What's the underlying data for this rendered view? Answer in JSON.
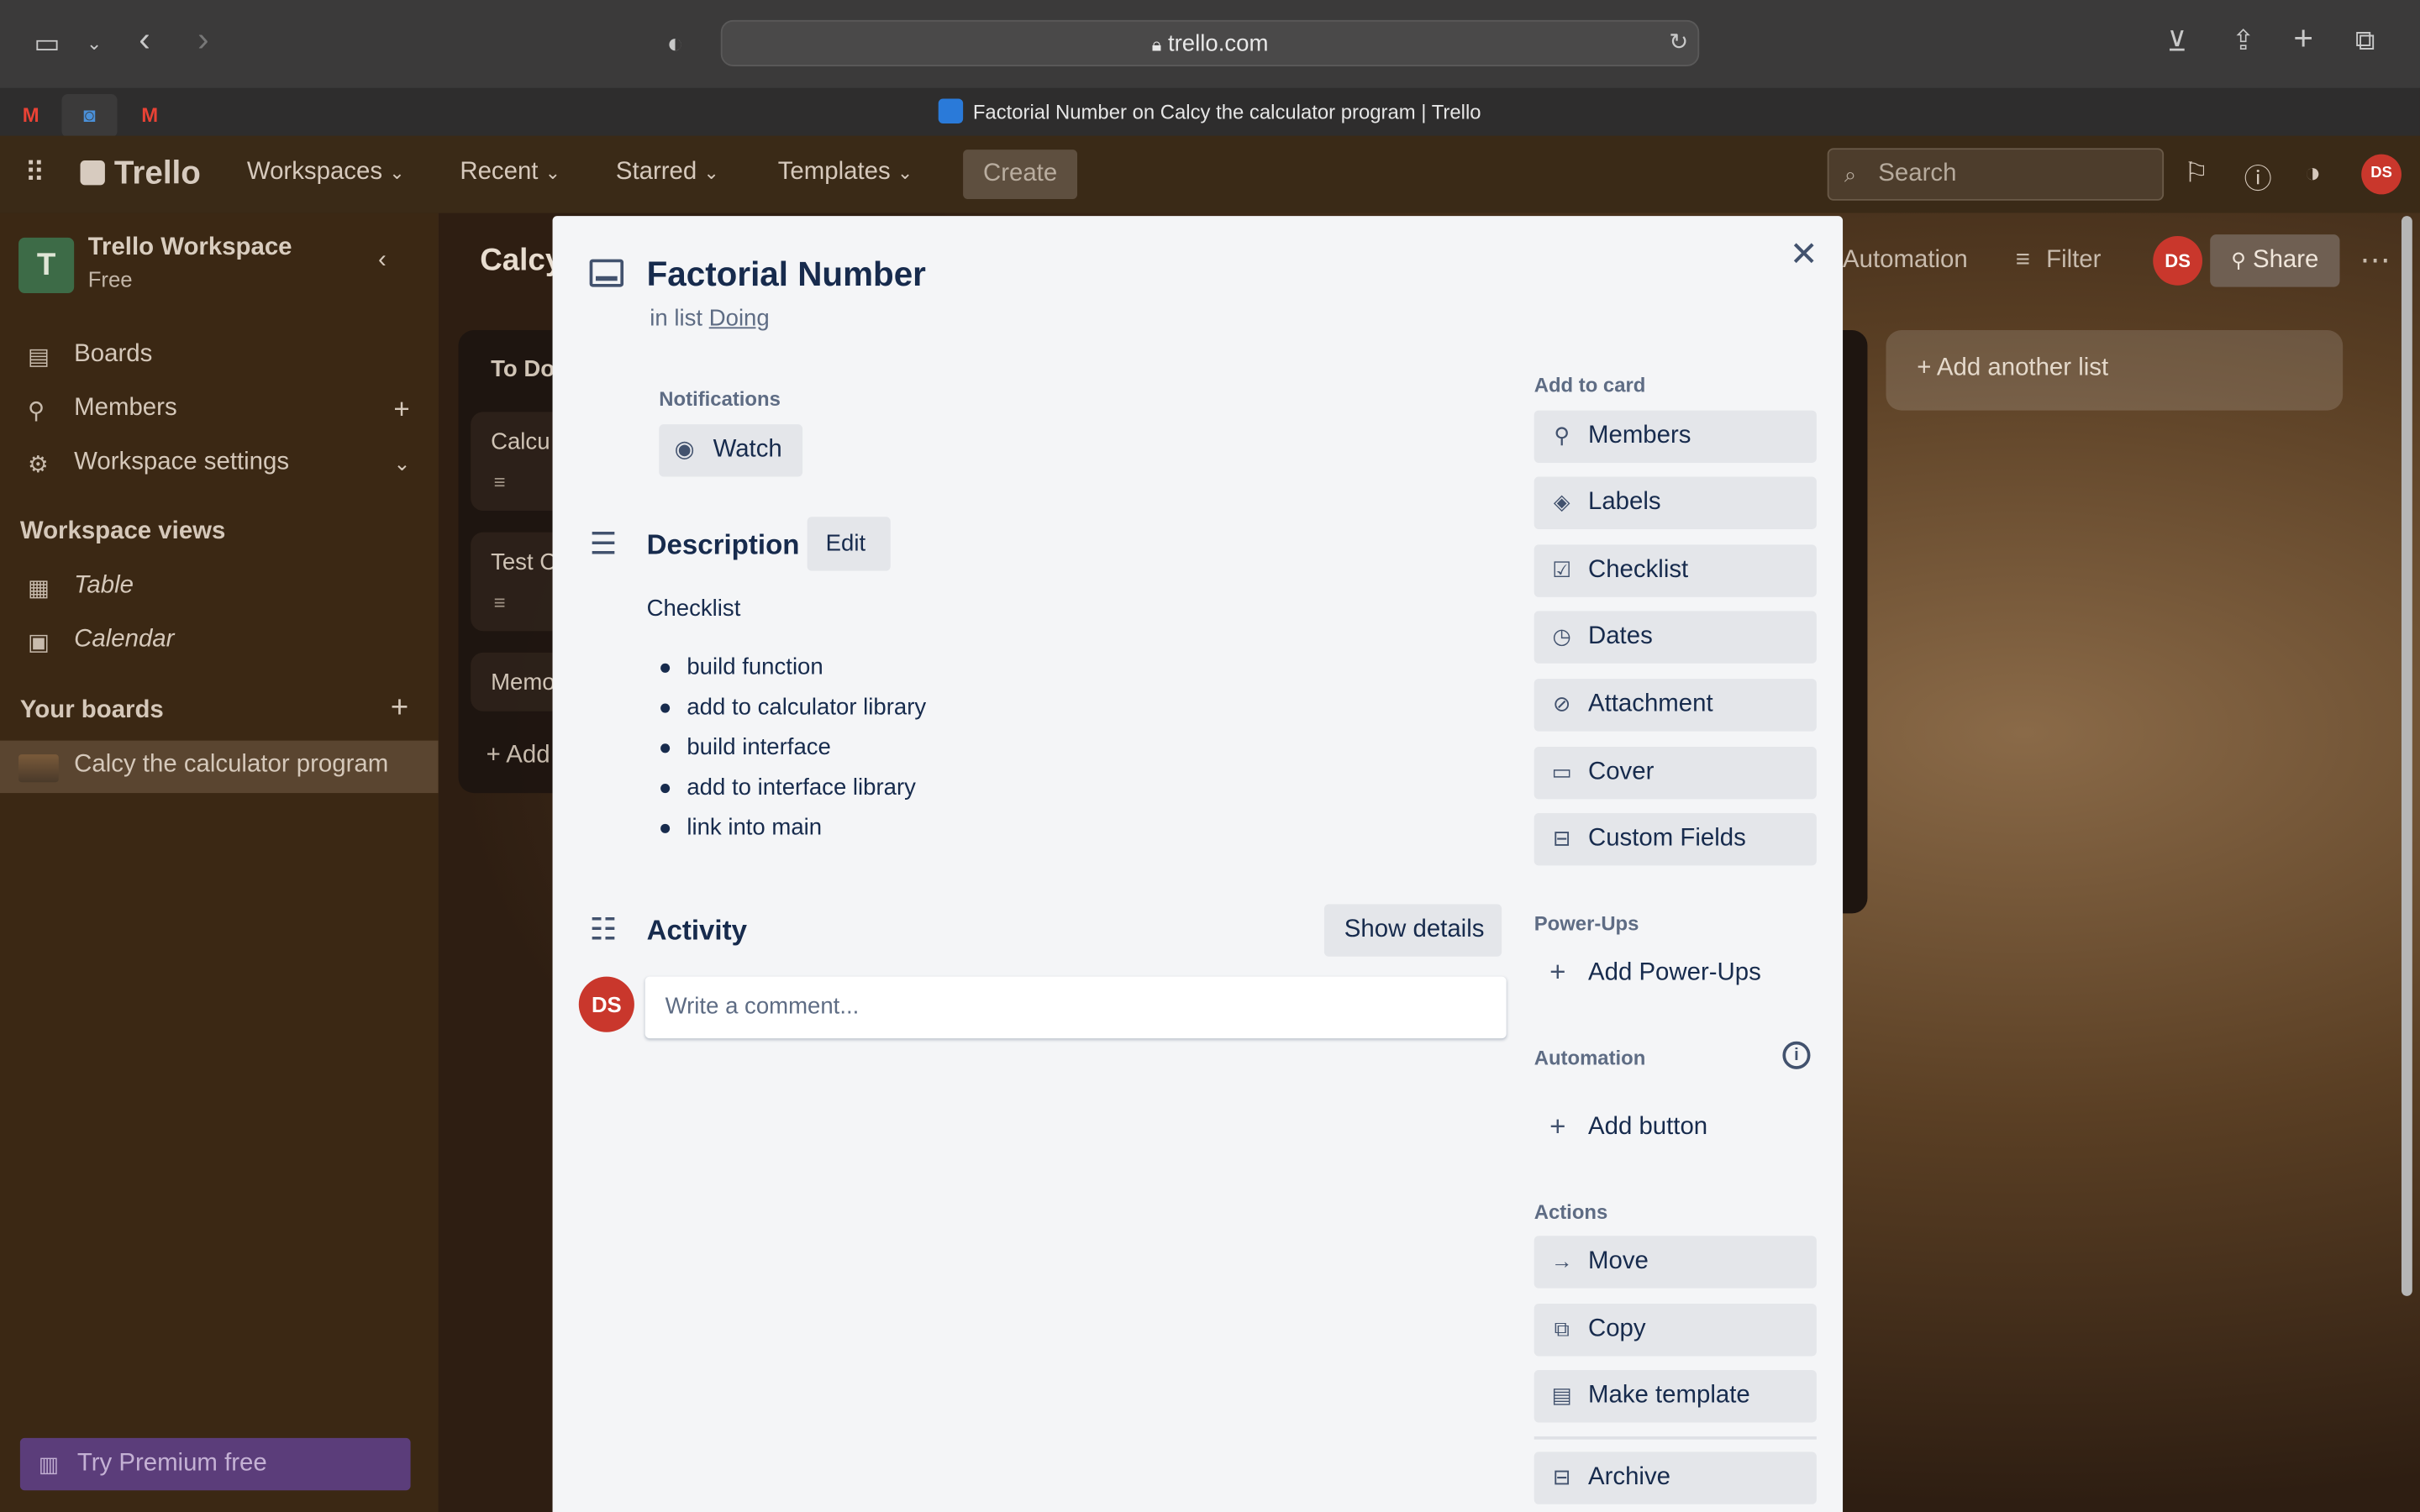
{
  "browser": {
    "url": "trello.com",
    "tab_title": "Factorial Number on Calcy the calculator program | Trello"
  },
  "header": {
    "logo": "Trello",
    "nav": [
      "Workspaces",
      "Recent",
      "Starred",
      "Templates"
    ],
    "create_label": "Create",
    "search_placeholder": "Search",
    "avatar": "DS"
  },
  "sidebar": {
    "workspace_initial": "T",
    "workspace_name": "Trello Workspace",
    "workspace_plan": "Free",
    "items": [
      {
        "label": "Boards"
      },
      {
        "label": "Members"
      },
      {
        "label": "Workspace settings"
      }
    ],
    "views_heading": "Workspace views",
    "views": [
      {
        "label": "Table"
      },
      {
        "label": "Calendar"
      }
    ],
    "boards_heading": "Your boards",
    "boards": [
      {
        "label": "Calcy the calculator program"
      }
    ],
    "premium_label": "Try Premium free"
  },
  "board": {
    "title": "Calcy",
    "automation_label": "Automation",
    "filter_label": "Filter",
    "avatar": "DS",
    "share_label": "Share",
    "add_list_label": "Add another list",
    "list": {
      "title": "To Do",
      "cards": [
        "Calcu",
        "Test C",
        "Memo"
      ],
      "add_label": "Add"
    }
  },
  "modal": {
    "title": "Factorial Number",
    "in_list_prefix": "in list",
    "list_name": "Doing",
    "notifications_label": "Notifications",
    "watch_label": "Watch",
    "description_title": "Description",
    "edit_label": "Edit",
    "description_text": "Checklist",
    "description_items": [
      "build function",
      "add to calculator library",
      "build interface",
      "add to interface library",
      "link into main"
    ],
    "activity_title": "Activity",
    "show_details_label": "Show details",
    "comment_avatar": "DS",
    "comment_placeholder": "Write a comment...",
    "add_to_card_heading": "Add to card",
    "add_to_card": [
      "Members",
      "Labels",
      "Checklist",
      "Dates",
      "Attachment",
      "Cover",
      "Custom Fields"
    ],
    "powerups_heading": "Power-Ups",
    "add_powerups_label": "Add Power-Ups",
    "automation_heading": "Automation",
    "add_button_label": "Add button",
    "actions_heading": "Actions",
    "actions": [
      "Move",
      "Copy",
      "Make template",
      "Archive"
    ]
  }
}
